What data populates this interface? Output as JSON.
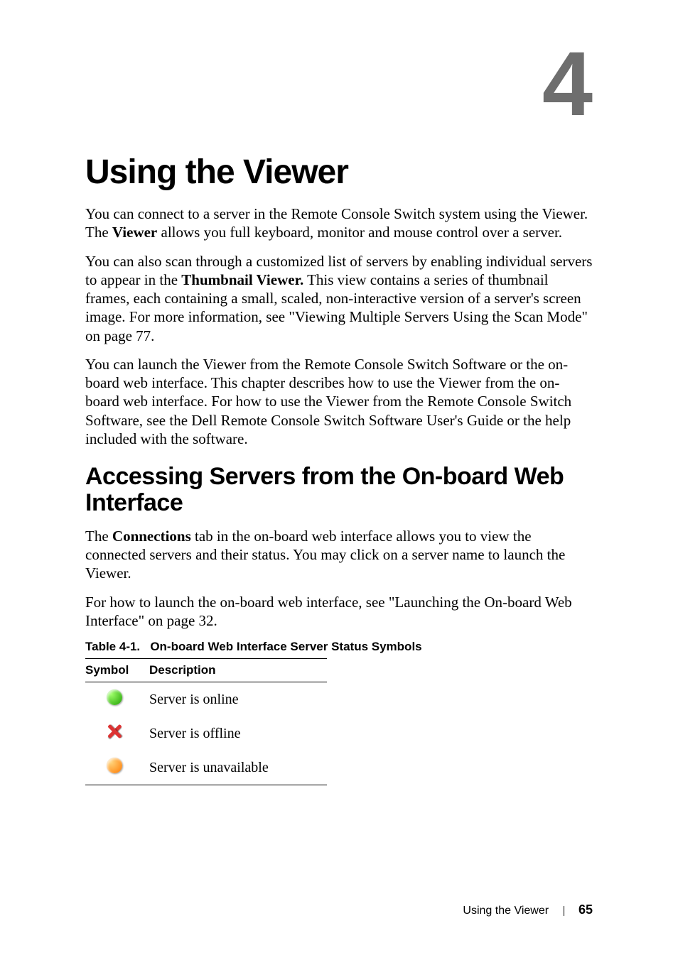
{
  "chapter_number": "4",
  "title": "Using the Viewer",
  "paragraphs": {
    "p1a": "You can connect to a server in the Remote Console Switch system using the Viewer. The ",
    "p1b": "Viewer",
    "p1c": " allows you full keyboard, monitor and mouse control over a server.",
    "p2a": "You can also scan through a customized list of servers by enabling individual servers to appear in the ",
    "p2b": "Thumbnail Viewer.",
    "p2c": " This view contains a series of thumbnail frames, each containing a small, scaled, non-interactive version of a server's screen image. For more information, see \"Viewing Multiple Servers Using the Scan Mode\" on page 77.",
    "p3": "You can launch the Viewer from the Remote Console Switch Software or the on-board web interface. This chapter describes how to use the Viewer from the on-board web interface. For how to use the Viewer from the Remote Console Switch Software, see the Dell Remote Console Switch Software User's Guide or the help included with the software."
  },
  "section_heading": "Accessing Servers from the On-board Web Interface",
  "section_paragraphs": {
    "s1a": "The ",
    "s1b": "Connections",
    "s1c": " tab in the on-board web interface allows you to view the connected servers and their status. You may click on a server name to launch the Viewer.",
    "s2": "For how to launch the on-board web interface, see \"Launching the On-board Web Interface\" on page 32."
  },
  "table": {
    "caption_prefix": "Table 4-1.",
    "caption_rest": "On-board Web Interface Server Status Symbols",
    "headers": {
      "symbol": "Symbol",
      "description": "Description"
    },
    "rows": [
      {
        "icon": "orb-green",
        "desc": "Server is online"
      },
      {
        "icon": "x-icon",
        "desc": "Server is offline"
      },
      {
        "icon": "orb-orange",
        "desc": "Server is unavailable"
      }
    ]
  },
  "footer": {
    "section": "Using the Viewer",
    "page": "65"
  }
}
